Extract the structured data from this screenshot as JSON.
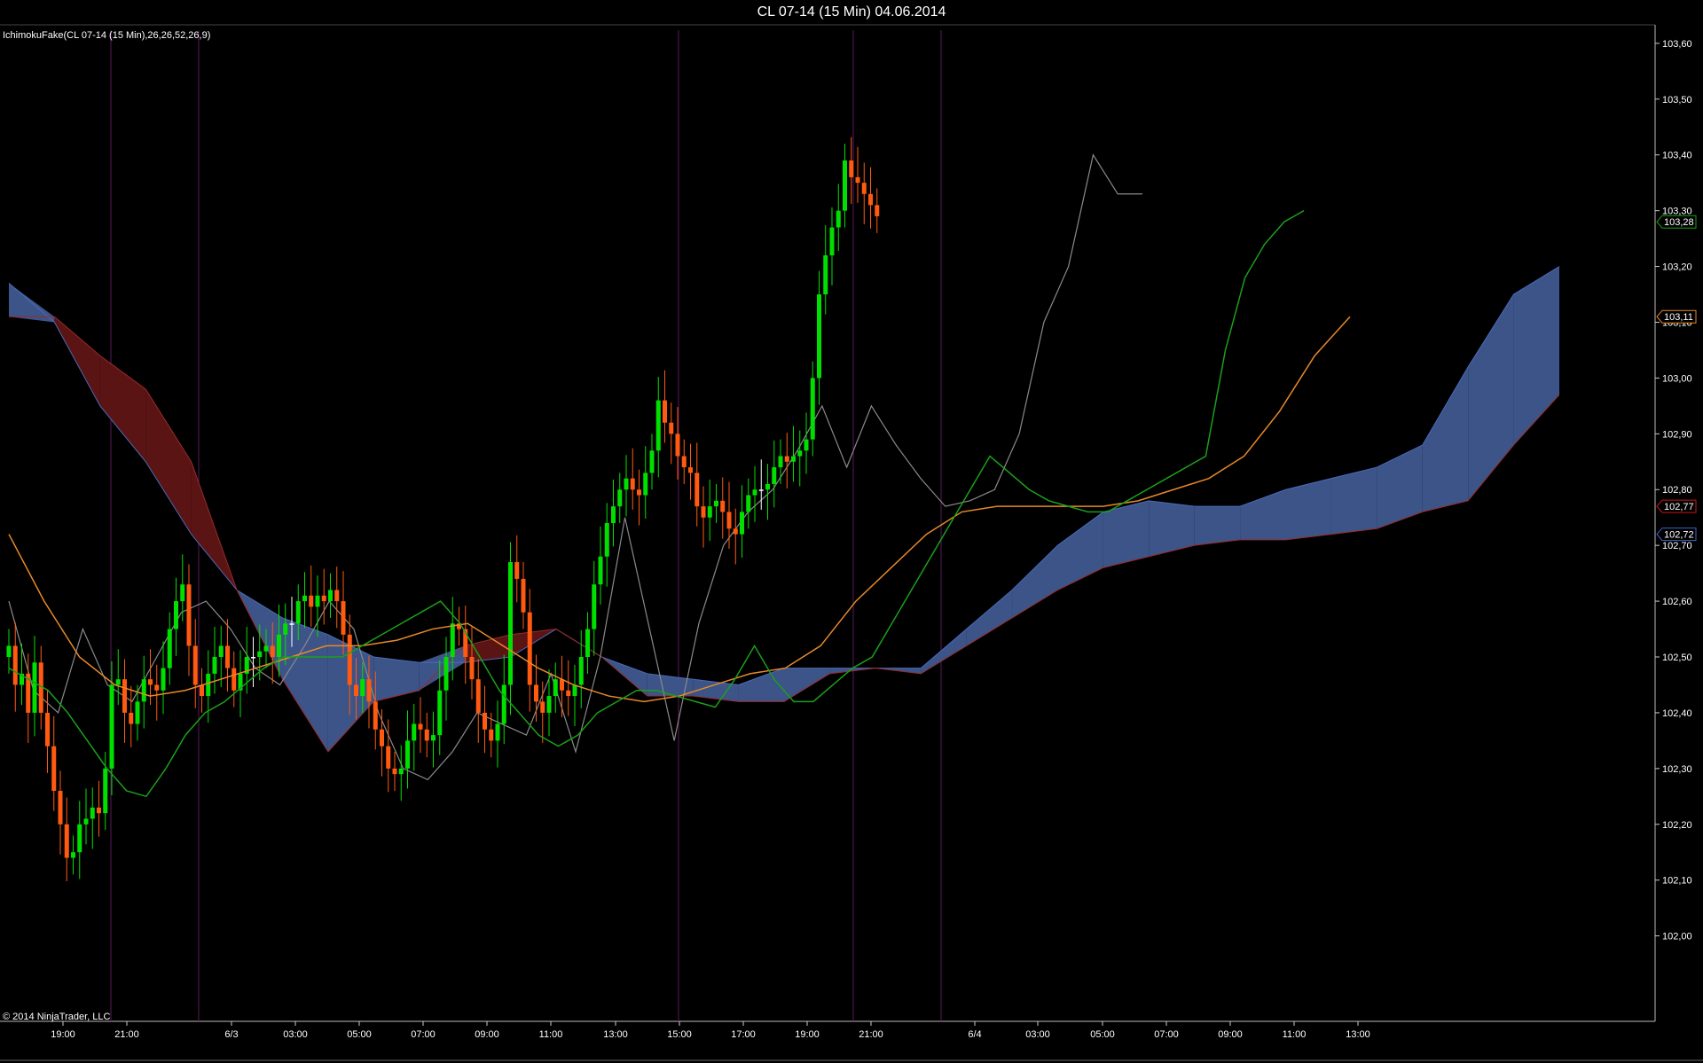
{
  "window": {
    "title": "CL 07-14 (15 Min)  04.06.2014"
  },
  "indicator": {
    "label": "IchimokuFake(CL 07-14 (15 Min),26,26,52,26,9)"
  },
  "copyright": "© 2014 NinjaTrader, LLC",
  "colors": {
    "background": "#000000",
    "bull_candle": "#00e000",
    "bear_candle": "#ff5a10",
    "doji_candle": "#ffffff",
    "tenkan": "#1aa01a",
    "kijun": "#e8892a",
    "chikou": "#8a8a8a",
    "cloud_bull": "#3c5488",
    "cloud_bear": "#5a1414",
    "session_line": "#5a1a5a",
    "axis": "#cccccc"
  },
  "chart_data": {
    "type": "candlestick",
    "symbol": "CL 07-14",
    "interval": "15 Min",
    "ylim": [
      101.85,
      103.63
    ],
    "y_ticks": [
      "103,60",
      "103,50",
      "103,40",
      "103,30",
      "103,20",
      "103,10",
      "103,00",
      "102,90",
      "102,80",
      "102,70",
      "102,60",
      "102,50",
      "102,40",
      "102,30",
      "102,20",
      "102,10",
      "102,00"
    ],
    "x_ticks": [
      "19:00",
      "21:00",
      "6/3",
      "03:00",
      "05:00",
      "07:00",
      "09:00",
      "11:00",
      "13:00",
      "15:00",
      "17:00",
      "19:00",
      "21:00",
      "6/4",
      "03:00",
      "05:00",
      "07:00",
      "09:00",
      "11:00",
      "13:00"
    ],
    "price_markers": [
      {
        "label": "103,28",
        "value": 103.28,
        "color": "#1aa01a"
      },
      {
        "label": "103,11",
        "value": 103.11,
        "color": "#e8892a"
      },
      {
        "label": "102,77",
        "value": 102.77,
        "color": "#c81818"
      },
      {
        "label": "102,72",
        "value": 102.72,
        "color": "#3c64c8"
      }
    ],
    "candles_close": [
      102.52,
      102.45,
      102.47,
      102.4,
      102.49,
      102.4,
      102.34,
      102.26,
      102.2,
      102.14,
      102.15,
      102.2,
      102.21,
      102.23,
      102.22,
      102.3,
      102.45,
      102.46,
      102.4,
      102.38,
      102.42,
      102.46,
      102.45,
      102.44,
      102.48,
      102.55,
      102.6,
      102.63,
      102.52,
      102.45,
      102.43,
      102.47,
      102.5,
      102.52,
      102.48,
      102.44,
      102.47,
      102.5,
      102.5,
      102.51,
      102.52,
      102.5,
      102.54,
      102.56,
      102.56,
      102.6,
      102.61,
      102.59,
      102.61,
      102.6,
      102.62,
      102.6,
      102.54,
      102.45,
      102.43,
      102.46,
      102.42,
      102.37,
      102.34,
      102.3,
      102.29,
      102.3,
      102.35,
      102.38,
      102.37,
      102.35,
      102.36,
      102.44,
      102.5,
      102.56,
      102.55,
      102.5,
      102.46,
      102.4,
      102.37,
      102.35,
      102.38,
      102.45,
      102.67,
      102.64,
      102.58,
      102.45,
      102.42,
      102.4,
      102.43,
      102.46,
      102.44,
      102.43,
      102.45,
      102.5,
      102.55,
      102.63,
      102.68,
      102.74,
      102.77,
      102.8,
      102.82,
      102.8,
      102.79,
      102.83,
      102.87,
      102.96,
      102.92,
      102.9,
      102.86,
      102.84,
      102.83,
      102.77,
      102.75,
      102.77,
      102.78,
      102.76,
      102.73,
      102.72,
      102.76,
      102.79,
      102.8,
      102.8,
      102.81,
      102.84,
      102.86,
      102.85,
      102.86,
      102.87,
      102.89,
      103.0,
      103.15,
      103.22,
      103.27,
      103.3,
      103.39,
      103.36,
      103.35,
      103.33,
      103.31,
      103.29
    ],
    "tenkan": [
      102.48,
      102.46,
      102.44,
      102.4,
      102.35,
      102.3,
      102.26,
      102.25,
      102.3,
      102.36,
      102.4,
      102.42,
      102.45,
      102.48,
      102.5,
      102.5,
      102.5,
      102.5,
      102.52,
      102.54,
      102.56,
      102.58,
      102.6,
      102.56,
      102.5,
      102.44,
      102.4,
      102.36,
      102.34,
      102.36,
      102.4,
      102.42,
      102.44,
      102.44,
      102.43,
      102.42,
      102.41,
      102.46,
      102.52,
      102.46,
      102.42,
      102.42,
      102.45,
      102.48,
      102.5,
      102.56,
      102.62,
      102.68,
      102.74,
      102.8,
      102.86,
      102.83,
      102.8,
      102.78,
      102.77,
      102.76,
      102.76,
      102.78,
      102.8,
      102.82,
      102.84,
      102.86,
      103.05,
      103.18,
      103.24,
      103.28,
      103.3
    ],
    "kijun": [
      102.72,
      102.6,
      102.5,
      102.45,
      102.43,
      102.44,
      102.46,
      102.48,
      102.5,
      102.52,
      102.52,
      102.53,
      102.55,
      102.56,
      102.52,
      102.48,
      102.45,
      102.43,
      102.42,
      102.43,
      102.45,
      102.47,
      102.48,
      102.52,
      102.6,
      102.66,
      102.72,
      102.76,
      102.77,
      102.77,
      102.77,
      102.77,
      102.78,
      102.8,
      102.82,
      102.86,
      102.94,
      103.04,
      103.11
    ],
    "chikou": [
      102.6,
      102.44,
      102.4,
      102.55,
      102.45,
      102.42,
      102.5,
      102.58,
      102.6,
      102.55,
      102.48,
      102.45,
      102.52,
      102.6,
      102.55,
      102.4,
      102.3,
      102.28,
      102.33,
      102.4,
      102.38,
      102.36,
      102.47,
      102.33,
      102.5,
      102.75,
      102.55,
      102.35,
      102.56,
      102.7,
      102.76,
      102.8,
      102.87,
      102.95,
      102.84,
      102.95,
      102.88,
      102.82,
      102.77,
      102.78,
      102.8,
      102.9,
      103.1,
      103.2,
      103.4,
      103.33,
      103.33
    ],
    "cloud_top": [
      103.17,
      103.1,
      102.95,
      102.85,
      102.72,
      102.62,
      102.57,
      102.54,
      102.5,
      102.49,
      102.49,
      102.5,
      102.55,
      102.5,
      102.47,
      102.46,
      102.45,
      102.48,
      102.48,
      102.48,
      102.48,
      102.55,
      102.62,
      102.7,
      102.76,
      102.78,
      102.77,
      102.77,
      102.8,
      102.82,
      102.84,
      102.88,
      103.02,
      103.15,
      103.2
    ],
    "cloud_bottom": [
      103.11,
      103.11,
      103.04,
      102.98,
      102.85,
      102.62,
      102.46,
      102.33,
      102.42,
      102.44,
      102.52,
      102.54,
      102.55,
      102.5,
      102.43,
      102.43,
      102.42,
      102.42,
      102.47,
      102.48,
      102.47,
      102.52,
      102.57,
      102.62,
      102.66,
      102.68,
      102.7,
      102.71,
      102.71,
      102.72,
      102.73,
      102.76,
      102.78,
      102.88,
      102.97
    ]
  }
}
